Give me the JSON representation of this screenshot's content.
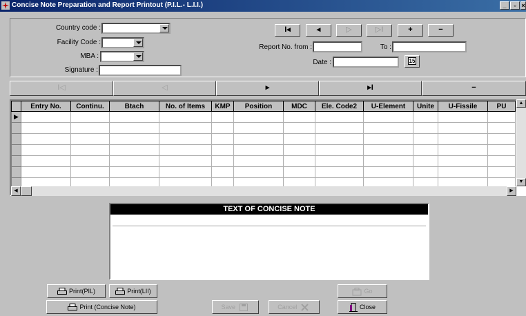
{
  "window": {
    "title": "Concise Note Preparation and Report Printout (P.I.L.- L.I.I.)"
  },
  "form": {
    "country_code_label": "Country code :",
    "facility_code_label": "Facility Code :",
    "mba_label": "MBA :",
    "signature_label": "Signature :",
    "report_from_label": "Report No. from :",
    "to_label": "To :",
    "date_label": "Date :",
    "calendar_glyph": "15"
  },
  "top_nav": {
    "first": "I◂",
    "prev": "◂",
    "next": "▷",
    "last": "▷I",
    "add": "+",
    "delete": "−"
  },
  "record_nav": {
    "first": "I◁",
    "prev": "◁",
    "next": "▸",
    "last": "▸I",
    "delete": "−"
  },
  "grid": {
    "columns": [
      "Entry No.",
      "Continu.",
      "Btach",
      "No. of Items",
      "KMP",
      "Position",
      "MDC",
      "Ele. Code2",
      "U-Element",
      "Unite",
      "U-Fissile",
      "PU"
    ],
    "row_count": 7
  },
  "note": {
    "header": "TEXT OF CONCISE NOTE"
  },
  "buttons": {
    "print_pil": "Print(PIL)",
    "print_lii": "Print(LII)",
    "print_concise": "Print (Concise Note)",
    "save": "Save",
    "cancel": "Cancel",
    "go": "Go",
    "close": "Close"
  },
  "colors": {
    "titlebar": "#0a246a",
    "face": "#c0c0c0",
    "note_header": "#000000"
  }
}
